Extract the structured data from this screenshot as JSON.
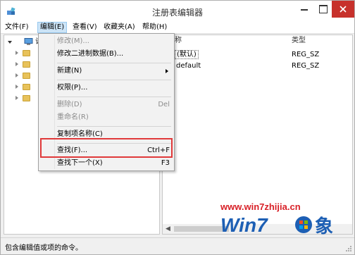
{
  "window": {
    "title": "注册表编辑器"
  },
  "menubar": [
    {
      "label": "文件(F)",
      "active": false
    },
    {
      "label": "编辑(E)",
      "active": true
    },
    {
      "label": "查看(V)",
      "active": false
    },
    {
      "label": "收藏夹(A)",
      "active": false
    },
    {
      "label": "帮助(H)",
      "active": false
    }
  ],
  "tree": {
    "root_label": "计"
  },
  "list": {
    "headers": {
      "name": "称",
      "type": "类型"
    },
    "rows": [
      {
        "name": "(默认)",
        "type": "REG_SZ"
      },
      {
        "name": "default",
        "type": "REG_SZ"
      }
    ]
  },
  "edit_menu": {
    "items": [
      {
        "label": "修改(M)...",
        "shortcut": "",
        "disabled": true,
        "submenu": false
      },
      {
        "label": "修改二进制数据(B)...",
        "shortcut": "",
        "disabled": false,
        "submenu": false
      },
      {
        "label": "新建(N)",
        "shortcut": "",
        "disabled": false,
        "submenu": true
      },
      {
        "label": "权限(P)...",
        "shortcut": "",
        "disabled": false,
        "submenu": false
      },
      {
        "label": "删除(D)",
        "shortcut": "Del",
        "disabled": true,
        "submenu": false
      },
      {
        "label": "重命名(R)",
        "shortcut": "",
        "disabled": true,
        "submenu": false
      },
      {
        "label": "复制项名称(C)",
        "shortcut": "",
        "disabled": false,
        "submenu": false
      },
      {
        "label": "查找(F)...",
        "shortcut": "Ctrl+F",
        "disabled": false,
        "submenu": false
      },
      {
        "label": "查找下一个(X)",
        "shortcut": "F3",
        "disabled": false,
        "submenu": false
      }
    ]
  },
  "statusbar": {
    "text": "包含编辑值或项的命令。"
  },
  "watermark": {
    "url": "www.win7zhijia.cn",
    "brand": "Win7",
    "suffix": "象"
  },
  "colors": {
    "highlight_border": "#e0393a",
    "close_button": "#c7312b",
    "watermark": "#d81f26",
    "logo_blue": "#1d5fb4"
  }
}
